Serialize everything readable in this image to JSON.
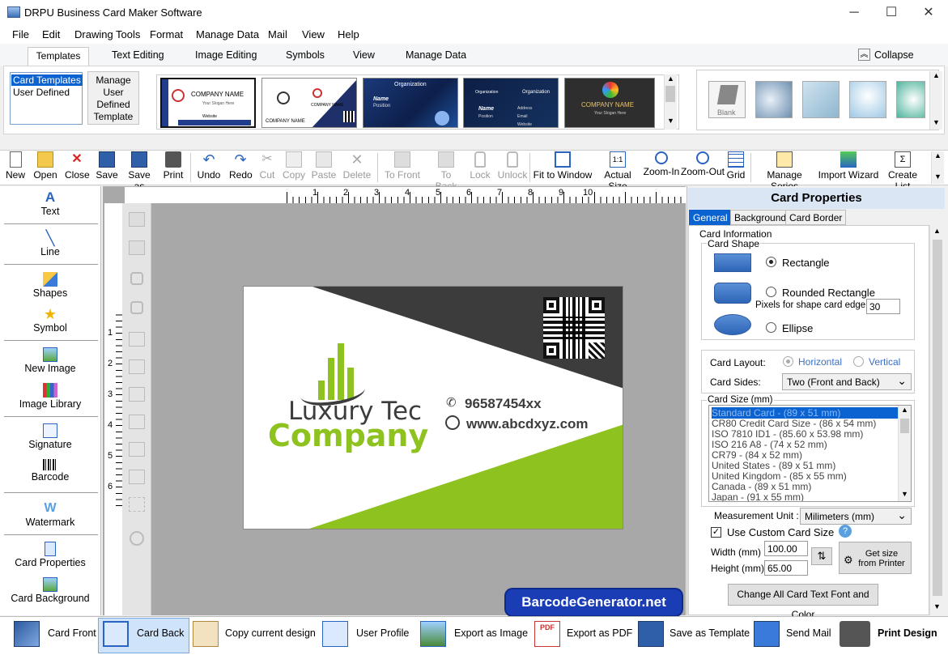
{
  "app": {
    "title": "DRPU Business Card Maker Software"
  },
  "menu": [
    "File",
    "Edit",
    "Drawing Tools",
    "Format",
    "Manage Data",
    "Mail",
    "View",
    "Help"
  ],
  "ribbon_tabs": [
    "Templates",
    "Text Editing",
    "Image Editing",
    "Symbols",
    "View",
    "Manage Data"
  ],
  "collapse_label": "Collapse",
  "template_list": [
    "Card Templates",
    "User Defined"
  ],
  "manage_template_label": "Manage User Defined Template",
  "thumbs": {
    "t1": {
      "company": "COMPANY NAME",
      "slogan": "Your Slogan Here",
      "website": "Website"
    },
    "t2": {
      "company": "COMPANY NAME",
      "company2": "COMPANY NAME"
    },
    "t3": {
      "org": "Organization",
      "name": "Name",
      "position": "Position"
    },
    "t4": {
      "org": "Organization",
      "org2": "Organization",
      "name": "Name",
      "position": "Position",
      "address": "Address",
      "email": "Email",
      "website": "Website"
    },
    "t5": {
      "company": "COMPANY NAME",
      "slogan": "Your Slogan Here"
    }
  },
  "bg_gallery": {
    "blank_label": "Blank"
  },
  "toolbar": [
    {
      "label": "New",
      "enabled": true
    },
    {
      "label": "Open",
      "enabled": true
    },
    {
      "label": "Close",
      "enabled": true
    },
    {
      "label": "Save",
      "enabled": true
    },
    {
      "label": "Save as",
      "enabled": true
    },
    {
      "label": "Print",
      "enabled": true
    },
    {
      "label": "Undo",
      "enabled": true
    },
    {
      "label": "Redo",
      "enabled": true
    },
    {
      "label": "Cut",
      "enabled": false
    },
    {
      "label": "Copy",
      "enabled": false
    },
    {
      "label": "Paste",
      "enabled": false
    },
    {
      "label": "Delete",
      "enabled": false
    },
    {
      "label": "To Front",
      "enabled": false
    },
    {
      "label": "To Back",
      "enabled": false
    },
    {
      "label": "Lock",
      "enabled": false
    },
    {
      "label": "Unlock",
      "enabled": false
    },
    {
      "label": "Fit to Window",
      "enabled": true
    },
    {
      "label": "Actual Size",
      "enabled": true
    },
    {
      "label": "Zoom-In",
      "enabled": true
    },
    {
      "label": "Zoom-Out",
      "enabled": true
    },
    {
      "label": "Grid",
      "enabled": true
    },
    {
      "label": "Manage Series",
      "enabled": true
    },
    {
      "label": "Import Wizard",
      "enabled": true
    },
    {
      "label": "Create List",
      "enabled": true
    }
  ],
  "left_tools": [
    "Text",
    "Line",
    "Shapes",
    "Symbol",
    "New Image",
    "Image Library",
    "Signature",
    "Barcode",
    "Watermark",
    "Card Properties",
    "Card Background"
  ],
  "ruler_top": [
    "1",
    "2",
    "3",
    "4",
    "5",
    "6",
    "7",
    "8",
    "9",
    "10"
  ],
  "ruler_left": [
    "1",
    "2",
    "3",
    "4",
    "5",
    "6"
  ],
  "card": {
    "company_line1": "Luxury Tec",
    "company_line2": "Company",
    "phone": "96587454xx",
    "website": "www.abcdxyz.com"
  },
  "props": {
    "title": "Card Properties",
    "tabs": [
      "General",
      "Background",
      "Card Border"
    ],
    "card_information": "Card Information",
    "card_shape": "Card Shape",
    "shape_rectangle": "Rectangle",
    "shape_rounded": "Rounded Rectangle",
    "pixels_label": "Pixels for shape card edge :",
    "pixels_value": "30",
    "shape_ellipse": "Ellipse",
    "layout_label": "Card Layout:",
    "layout_horizontal": "Horizontal",
    "layout_vertical": "Vertical",
    "sides_label": "Card Sides:",
    "sides_value": "Two (Front and Back)",
    "size_label": "Card Size (mm)",
    "sizes": [
      "Standard Card  -  (89 x 51 mm)",
      "CR80 Credit Card Size  -  (86 x 54 mm)",
      "ISO 7810 ID1  -  (85.60 x 53.98 mm)",
      "ISO 216  A8  -  (74 x 52 mm)",
      "CR79  -  (84 x 52 mm)",
      "United States  -  (89 x 51 mm)",
      "United Kingdom  -  (85 x 55 mm)",
      "Canada  -  (89 x 51 mm)",
      "Japan  -  (91 x 55 mm)"
    ],
    "unit_label": "Measurement Unit :",
    "unit_value": "Milimeters (mm)",
    "custom_label": "Use Custom Card Size",
    "width_label": "Width  (mm)",
    "width_value": "100.00",
    "height_label": "Height  (mm)",
    "height_value": "65.00",
    "get_size_label": "Get size from Printer",
    "change_all_label": "Change All Card Text Font and Color"
  },
  "watermark_text": "BarcodeGenerator.net",
  "bottom": [
    "Card Front",
    "Card Back",
    "Copy current design",
    "User Profile",
    "Export as Image",
    "Export as PDF",
    "Save as Template",
    "Send Mail",
    "Print Design"
  ],
  "colors": {
    "green": "#8dc21f",
    "dark": "#3c3c3c",
    "accent": "#1a3db5"
  }
}
